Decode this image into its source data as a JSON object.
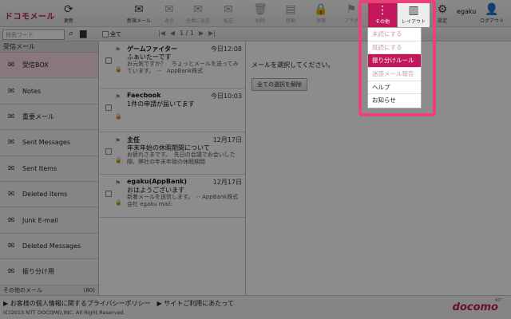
{
  "app": {
    "logo": "ドコモメール",
    "brand": "docomo",
    "brand_small": "NTT"
  },
  "toolbar": {
    "refresh": "更新",
    "new_mail": "新規メール",
    "reply": "返信",
    "reply_all": "全員に返信",
    "forward": "転送",
    "delete": "削除",
    "move": "移動",
    "protect": "保護",
    "flag": "フラグ",
    "other": "その他",
    "layout": "レイアウト",
    "settings": "設定",
    "user": "egaku",
    "logout": "ログアウト"
  },
  "subbar": {
    "search_placeholder": "検索ワード",
    "select_all": "全て",
    "page": "1 / 1"
  },
  "sidebar": {
    "heading": "受信メール",
    "folders": [
      {
        "label": "受信BOX"
      },
      {
        "label": "Notes"
      },
      {
        "label": "重要メール"
      },
      {
        "label": "Sent Messages"
      },
      {
        "label": "Sent Items"
      },
      {
        "label": "Deleted Items"
      },
      {
        "label": "Junk E-mail"
      },
      {
        "label": "Deleted Messages"
      },
      {
        "label": "振り分け用"
      }
    ],
    "more_label": "その他のメール",
    "more_count": "(80)"
  },
  "messages": [
    {
      "sender": "ゲームファイター",
      "date": "今日12:08",
      "subject": "ふぁいたーです",
      "preview": "お元気ですか？　ちょっとメールを送ってみています。　--　AppBank株式"
    },
    {
      "sender": "Faecbook",
      "date": "今日10:03",
      "subject": "1件の申請が届いてます",
      "preview": ""
    },
    {
      "sender": "主任",
      "date": "12月17日",
      "subject": "年末年始の休暇期間について",
      "preview": "お疲れさまです。　先日の会議でお会いした際、弊社の年末年始の休暇期間"
    },
    {
      "sender": "egaku(AppBank)",
      "date": "12月17日",
      "subject": "おはようございます",
      "preview": "新着メールを送信します。　-- AppBank株式会社 egaku mail:"
    }
  ],
  "pane": {
    "message": "メールを選択してください。",
    "deselect": "全ての選択を解除"
  },
  "menu": {
    "items": [
      {
        "label": "未読にする",
        "state": "disabled"
      },
      {
        "label": "既読にする",
        "state": "disabled"
      },
      {
        "label": "振り分けルール",
        "state": "highlighted"
      },
      {
        "label": "迷惑メール報告",
        "state": "disabled"
      },
      {
        "label": "ヘルプ",
        "state": "normal"
      },
      {
        "label": "お知らせ",
        "state": "normal"
      }
    ]
  },
  "footer": {
    "privacy": "お客様の個人情報に関するプライバシーポリシー",
    "terms": "サイトご利用にあたって",
    "copyright": "(C)2013 NTT DOCOMO,INC. All Right Reserved."
  },
  "colors": {
    "accent": "#c2185b",
    "highlight_frame": "#ec407a"
  }
}
